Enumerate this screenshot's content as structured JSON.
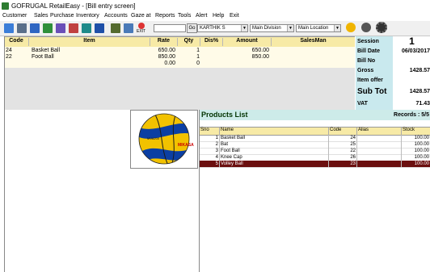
{
  "window": {
    "title": "GOFRUGAL RetailEasy - [Bill entry screen]"
  },
  "menu": [
    "Customer",
    "Sales",
    "Purchase",
    "Inventory",
    "Accounts",
    "Gaze at",
    "Reports",
    "Tools",
    "Alert",
    "Help",
    "Exit"
  ],
  "toolbar": {
    "exit_label": "EXIT",
    "go_label": "Go",
    "salesman_value": "KARTHIK S",
    "division_value": "Main Division",
    "location_value": "Main Location"
  },
  "bill_grid": {
    "headers": [
      "Code",
      "Item",
      "Rate",
      "Qty",
      "Dis%",
      "Amount",
      "SalesMan"
    ],
    "rows": [
      {
        "code": "24",
        "item": "Basket Ball",
        "rate": "650.00",
        "qty": "1",
        "dis": "",
        "amount": "650.00",
        "salesman": ""
      },
      {
        "code": "22",
        "item": "Foot Ball",
        "rate": "850.00",
        "qty": "1",
        "dis": "",
        "amount": "850.00",
        "salesman": ""
      }
    ],
    "totals": {
      "rate": "0.00",
      "qty": "0"
    }
  },
  "summary": {
    "session_label": "Session",
    "session_value": "1",
    "bill_date_label": "Bill Date",
    "bill_date_value": "06/03/2017",
    "bill_no_label": "Bill No",
    "bill_no_value": "",
    "gross_label": "Gross",
    "gross_value": "1428.57",
    "item_offer_label": "Item offer",
    "item_offer_value": "",
    "sub_tot_label": "Sub Tot",
    "sub_tot_value": "1428.57",
    "vat_label": "VAT",
    "vat_value": "71.43"
  },
  "products": {
    "title": "Products List",
    "records": "Records : 5/5",
    "headers": [
      "Sno",
      "Name",
      "Code",
      "Alias",
      "Stock"
    ],
    "rows": [
      {
        "sno": "1",
        "name": "Basket Ball",
        "code": "24",
        "alias": "",
        "stock": "100.00"
      },
      {
        "sno": "2",
        "name": "Bat",
        "code": "25",
        "alias": "",
        "stock": "100.00"
      },
      {
        "sno": "3",
        "name": "Foot Ball",
        "code": "22",
        "alias": "",
        "stock": "100.00"
      },
      {
        "sno": "4",
        "name": "Knee Cap",
        "code": "26",
        "alias": "",
        "stock": "100.00"
      },
      {
        "sno": "5",
        "name": "Volley Ball",
        "code": "23",
        "alias": "",
        "stock": "100.00"
      }
    ]
  },
  "product_image": {
    "brand_text": "MIKASA",
    "model_text": "MVA200"
  },
  "colors": {
    "header": "#f7eaa6",
    "panel": "#c9e9ee",
    "selected": "#6b0f0f",
    "ball_yellow": "#f2c200",
    "ball_blue": "#0b3fa3"
  }
}
